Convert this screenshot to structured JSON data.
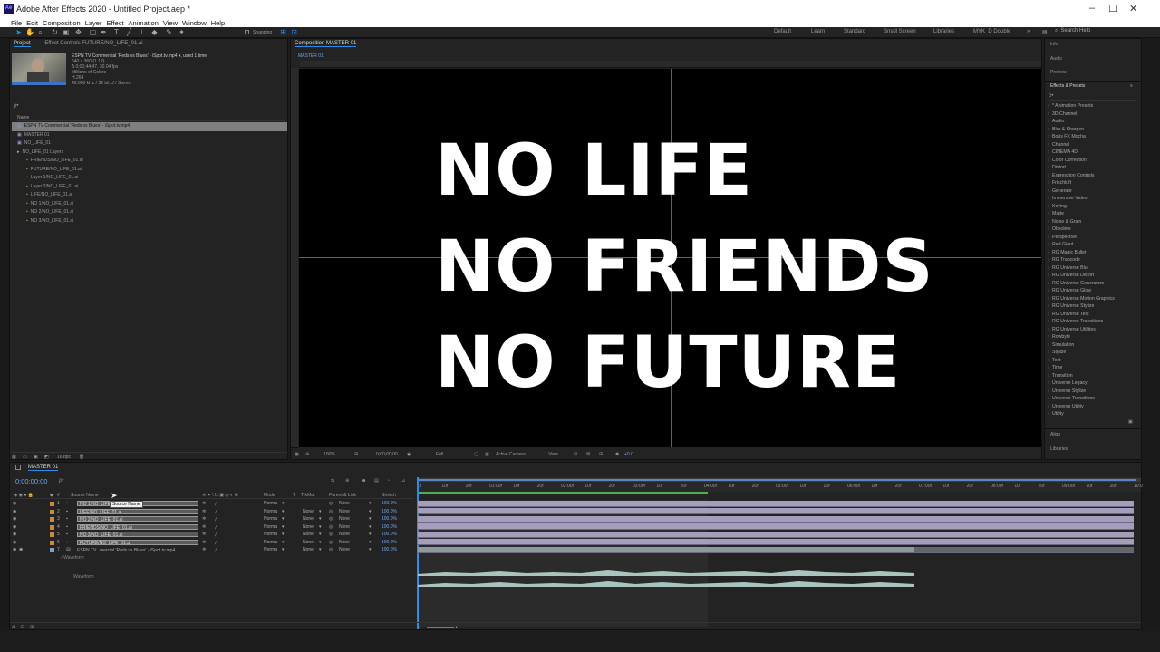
{
  "window": {
    "title": "Adobe After Effects 2020 - Untitled Project.aep *"
  },
  "menu": [
    "File",
    "Edit",
    "Composition",
    "Layer",
    "Effect",
    "Animation",
    "View",
    "Window",
    "Help"
  ],
  "toolbar": {
    "snapping_label": "Snapping",
    "search_help": "Search Help"
  },
  "workspaces": [
    "Default",
    "Learn",
    "Standard",
    "Small Screen",
    "Libraries",
    "MYK_D Double"
  ],
  "project": {
    "tabs": [
      "Project",
      "Effect Controls FUTURE/NO_LIFE_01.ai"
    ],
    "selected_name": "ESPN TV Commercial 'Reds vs Blues' - iSpot.tv.mp4",
    "used_text": ", used 1 time",
    "info_lines": [
      "640 x 360 (1.12)",
      "Δ 0;00;44;47, 30.04 fps",
      "Millions of Colors",
      "H.264",
      "48.000 kHz / 32 bit U / Stereo"
    ],
    "search_placeholder": "ρ•",
    "col_name": "Name",
    "items": [
      {
        "name": "ESPN TV Commercial 'Reds vs Blues' - iSpot.tv.mp4",
        "indent": 0,
        "selected": true,
        "kind": "footage"
      },
      {
        "name": "MASTER 01",
        "indent": 0,
        "kind": "comp"
      },
      {
        "name": "NO_LIFE_01",
        "indent": 0,
        "kind": "comp"
      },
      {
        "name": "NO_LIFE_01 Layers",
        "indent": 0,
        "kind": "folder"
      },
      {
        "name": "FRIENDS/NO_LIFE_01.ai",
        "indent": 1,
        "kind": "ai"
      },
      {
        "name": "FUTURE/NO_LIFE_01.ai",
        "indent": 1,
        "kind": "ai"
      },
      {
        "name": "Layer 1/NO_LIFE_01.ai",
        "indent": 1,
        "kind": "ai"
      },
      {
        "name": "Layer 2/NO_LIFE_01.ai",
        "indent": 1,
        "kind": "ai"
      },
      {
        "name": "LIFE/NO_LIFE_01.ai",
        "indent": 1,
        "kind": "ai"
      },
      {
        "name": "NO 1/NO_LIFE_01.ai",
        "indent": 1,
        "kind": "ai"
      },
      {
        "name": "NO 2/NO_LIFE_01.ai",
        "indent": 1,
        "kind": "ai"
      },
      {
        "name": "NO 3/NO_LIFE_01.ai",
        "indent": 1,
        "kind": "ai"
      }
    ],
    "bpc": "16 bpc"
  },
  "composition": {
    "tab": "Composition MASTER 01",
    "breadcrumb": "MASTER 01",
    "lines": [
      "NO LIFE",
      "NO FRIENDS",
      "NO FUTURE"
    ],
    "zoom": "100%",
    "timecode": "0;00;00;00",
    "resolution": "Full",
    "camera": "Active Camera",
    "views": "1 View",
    "exposure": "+0.0"
  },
  "right_panels": {
    "headers": [
      "Info",
      "Audio",
      "Preview"
    ],
    "effects_title": "Effects & Presets",
    "effects_search_placeholder": "ρ•",
    "effects": [
      "* Animation Presets",
      "3D Channel",
      "Audio",
      "Blur & Sharpen",
      "Boris FX Mocha",
      "Channel",
      "CINEMA 4D",
      "Color Correction",
      "Distort",
      "Expression Controls",
      "Frischluft",
      "Generate",
      "Immersive Video",
      "Keying",
      "Matte",
      "Noise & Grain",
      "Obsolete",
      "Perspective",
      "Red Giant",
      "RG Magic Bullet",
      "RG Trapcode",
      "RG Universe Blur",
      "RG Universe Distort",
      "RG Universe Generators",
      "RG Universe Glow",
      "RG Universe Motion Graphics",
      "RG Universe Stylize",
      "RG Universe Text",
      "RG Universe Transitions",
      "RG Universe Utilities",
      "Rowbyte",
      "Simulation",
      "Stylize",
      "Text",
      "Time",
      "Transition",
      "Universe Legacy",
      "Universe Stylize",
      "Universe Transitions",
      "Universe Utility",
      "Utility"
    ],
    "footers": [
      "Align",
      "Libraries"
    ]
  },
  "timeline": {
    "tab": "MASTER 01",
    "timecode": "0;00;00;00",
    "search_placeholder": "ρ•",
    "col_source": "Source Name",
    "col_mode": "Mode",
    "col_t": "T",
    "col_trkmat": "TrkMat",
    "col_parent": "Parent & Link",
    "col_stretch": "Stretch",
    "tooltip": "Source Name",
    "ruler_labels": [
      "0f",
      "10f",
      "20f",
      "01:00f",
      "10f",
      "20f",
      "02:00f",
      "10f",
      "20f",
      "03:00f",
      "10f",
      "20f",
      "04:00f",
      "10f",
      "20f",
      "05:00f",
      "10f",
      "20f",
      "06:00f",
      "10f",
      "20f",
      "07:00f",
      "10f",
      "20f",
      "08:00f",
      "10f",
      "20f",
      "09:00f",
      "10f",
      "20f",
      "10:0"
    ],
    "layers": [
      {
        "num": "1",
        "name": "NO 1/NO_LIFE_01.ai",
        "mode": "Norma",
        "trkmat": "",
        "parent": "None",
        "stretch": "100.0%"
      },
      {
        "num": "2",
        "name": "LIFE/NO_LIFE_01.ai",
        "mode": "Norma",
        "trkmat": "None",
        "parent": "None",
        "stretch": "100.0%"
      },
      {
        "num": "3",
        "name": "NO 2/NO_LIFE_01.ai",
        "mode": "Norma",
        "trkmat": "None",
        "parent": "None",
        "stretch": "100.0%"
      },
      {
        "num": "4",
        "name": "FRIENDS/NO_LIFE_01.ai",
        "mode": "Norma",
        "trkmat": "None",
        "parent": "None",
        "stretch": "100.0%"
      },
      {
        "num": "5",
        "name": "NO 3/NO_LIFE_01.ai",
        "mode": "Norma",
        "trkmat": "None",
        "parent": "None",
        "stretch": "100.0%"
      },
      {
        "num": "6",
        "name": "FUTURE/NO_LIFE_01.ai",
        "mode": "Norma",
        "trkmat": "None",
        "parent": "None",
        "stretch": "100.0%"
      },
      {
        "num": "7",
        "name": "ESPN TV...mercial 'Reds vs Blues' - iSpot.tv.mp4",
        "mode": "Norma",
        "trkmat": "None",
        "parent": "None",
        "stretch": "100.0%"
      }
    ],
    "waveform_group": "Waveform",
    "waveform_label": "Waveform"
  }
}
